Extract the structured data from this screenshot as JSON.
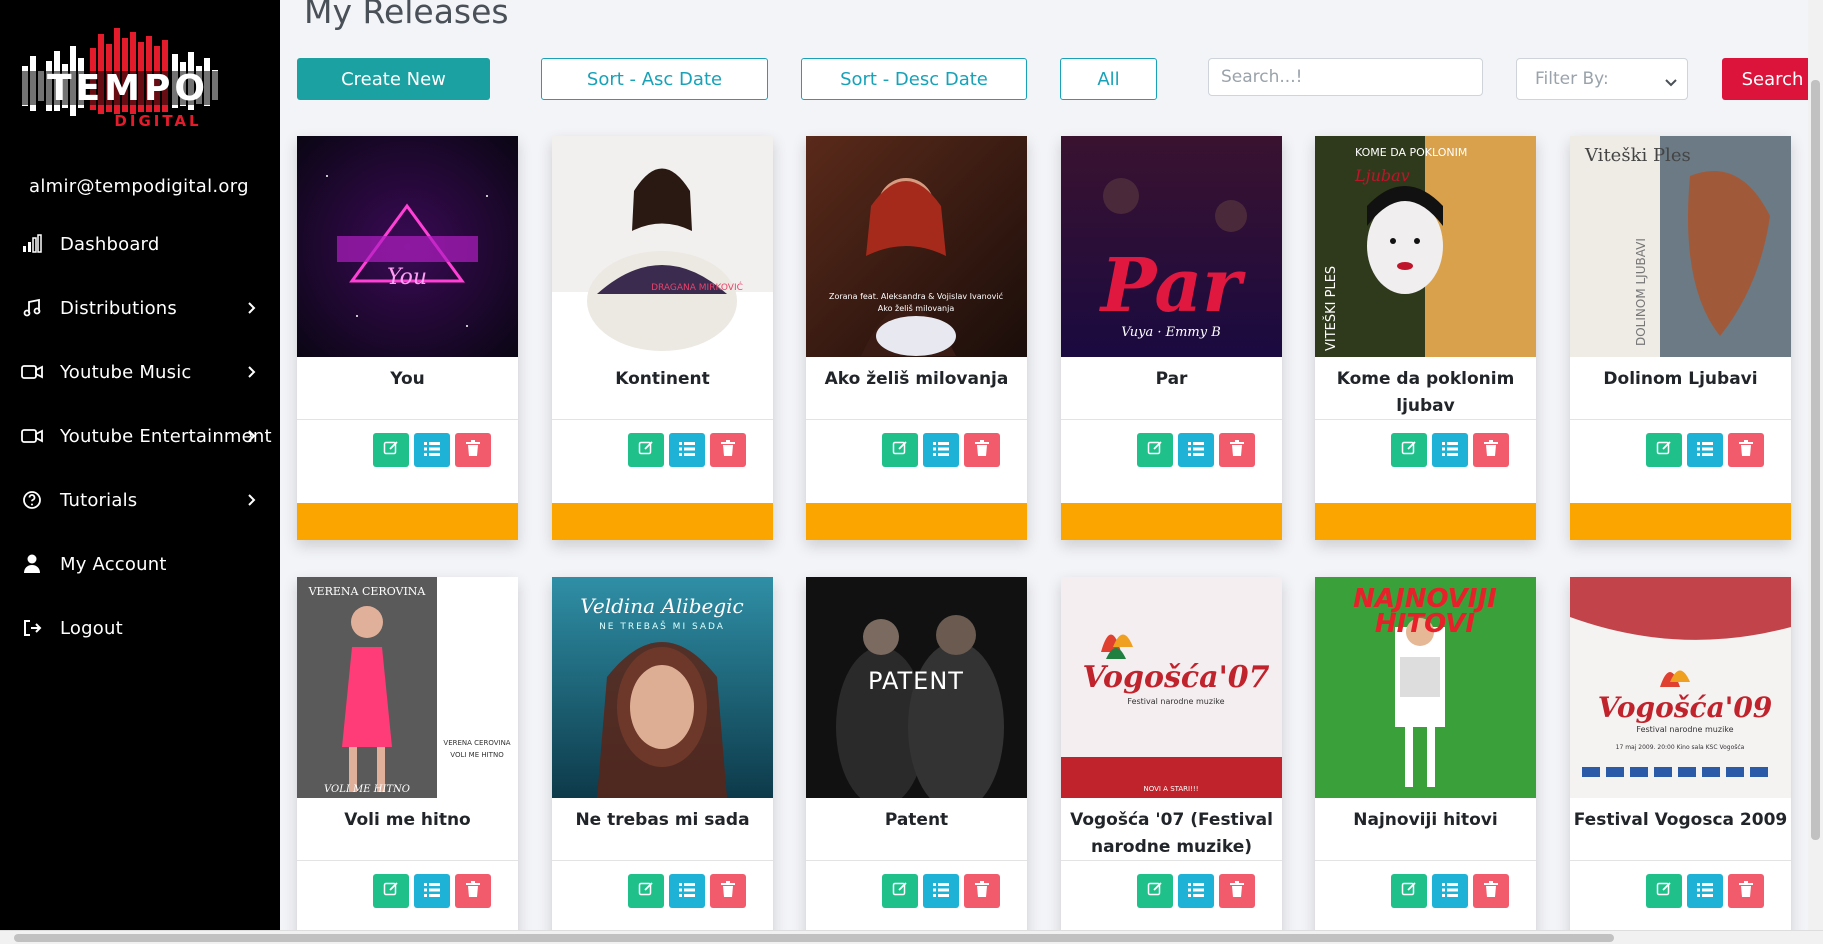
{
  "user": {
    "email": "almir@tempodigital.org"
  },
  "logo": {
    "text": "TEMPO",
    "subtext": "DIGITAL"
  },
  "sidebar": {
    "items": [
      {
        "label": "Dashboard",
        "icon": "bar-chart-icon",
        "has_submenu": false
      },
      {
        "label": "Distributions",
        "icon": "music-note-icon",
        "has_submenu": true
      },
      {
        "label": "Youtube Music",
        "icon": "video-camera-icon",
        "has_submenu": true
      },
      {
        "label": "Youtube Entertainment",
        "icon": "video-camera-icon",
        "has_submenu": true
      },
      {
        "label": "Tutorials",
        "icon": "question-circle-icon",
        "has_submenu": true
      },
      {
        "label": "My Account",
        "icon": "user-icon",
        "has_submenu": false
      },
      {
        "label": "Logout",
        "icon": "logout-icon",
        "has_submenu": false
      }
    ]
  },
  "page": {
    "title": "My Releases"
  },
  "toolbar": {
    "create_new": "Create New",
    "sort_asc": "Sort - Asc Date",
    "sort_desc": "Sort - Desc Date",
    "all": "All",
    "search_placeholder": "Search...!",
    "filter_placeholder": "Filter By:",
    "search_button": "Search"
  },
  "colors": {
    "create_new": "#1ba1a1",
    "outline": "#17a2b8",
    "search_button": "#dc143c",
    "edit": "#20c08a",
    "list": "#1eb2d6",
    "delete": "#f25b6c",
    "status_pending": "#fba600"
  },
  "releases": [
    {
      "title": "You"
    },
    {
      "title": "Kontinent"
    },
    {
      "title": "Ako želiš milovanja"
    },
    {
      "title": "Par"
    },
    {
      "title": "Kome da poklonim ljubav"
    },
    {
      "title": "Dolinom Ljubavi"
    },
    {
      "title": "Voli me hitno"
    },
    {
      "title": "Ne trebas mi sada"
    },
    {
      "title": "Patent"
    },
    {
      "title": "Vogošća '07 (Festival narodne muzike)"
    },
    {
      "title": "Najnoviji hitovi"
    },
    {
      "title": "Festival Vogosca 2009"
    }
  ],
  "cover_text": {
    "you": "You",
    "kontinent": "DRAGANA MIRKOVIĆ",
    "ako_line1": "Zorana feat. Aleksandra & Vojislav Ivanović",
    "ako_line2": "Ako želiš milovanja",
    "par_main": "Par",
    "par_sub": "Vuya · Emmy B",
    "kome_side": "VITEŠKI PLES",
    "kome_top": "KOME DA POKLONIM",
    "kome_script": "Ljubav",
    "dolinom_top": "Viteški Ples",
    "dolinom_side": "DOLINOM LJUBAVI",
    "voli_top": "VERENA CEROVINA",
    "voli_right1": "VERENA CEROVINA",
    "voli_right2": "VOLI ME HITNO",
    "voli_bottom": "VOLI ME HITNO",
    "ne_trebas_top": "Veldina Alibegic",
    "ne_trebas_sub": "NE TREBAŠ MI SADA",
    "patent": "PATENT",
    "vogosca07_title": "Vogošća'07",
    "vogosca07_sub": "Festival narodne muzike",
    "vogosca07_bottom": "NOVI A STARI!!!",
    "najnoviji_line1": "NAJNOVIJI",
    "najnoviji_line2": "HITOVI",
    "vogosca09_title": "Vogošća'09",
    "vogosca09_sub": "Festival narodne muzike",
    "vogosca09_date": "17 maj 2009. 20:00 Kino sala KSC Vogošća"
  }
}
